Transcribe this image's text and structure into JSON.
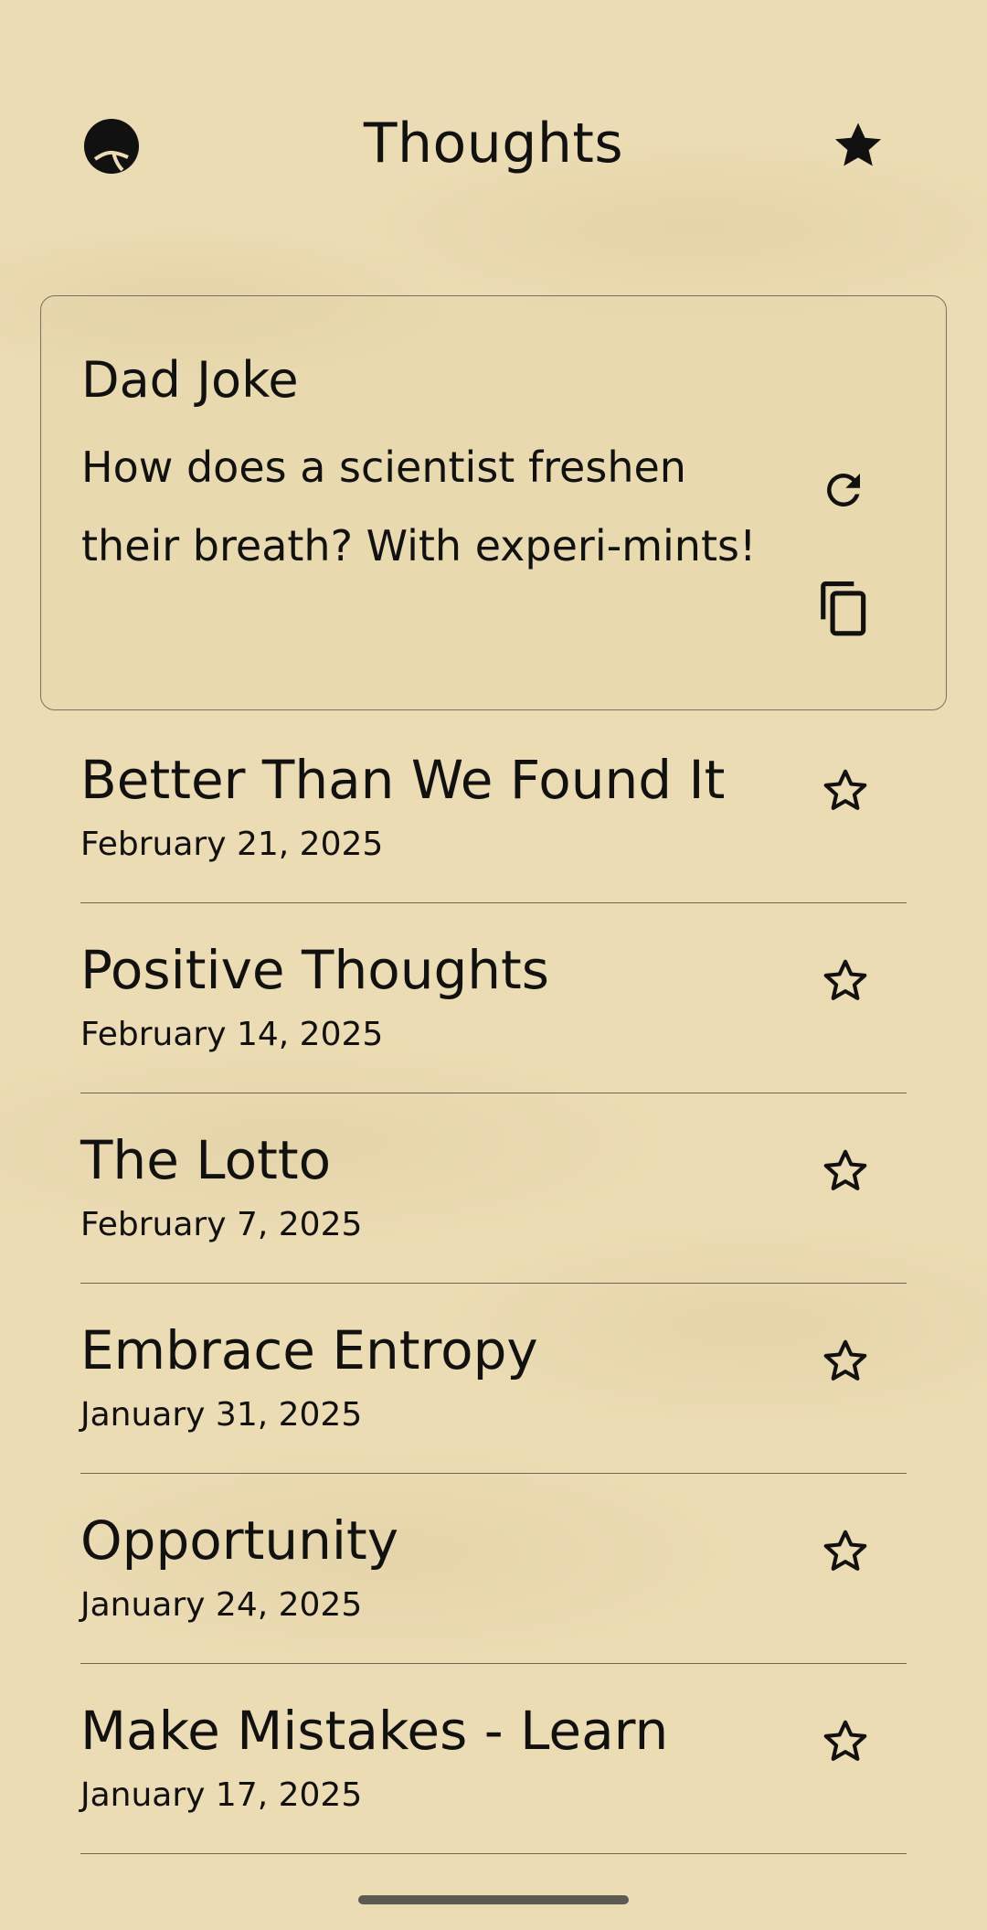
{
  "header": {
    "title": "Thoughts",
    "left_icon": "globe-icon",
    "right_icon": "star-filled-icon"
  },
  "joke": {
    "title": "Dad Joke",
    "text": "How does a scientist freshen their breath? With experi-mints!",
    "refresh_icon": "refresh-icon",
    "copy_icon": "copy-icon"
  },
  "entries": [
    {
      "title": "Better Than We Found It",
      "date": "February 21, 2025",
      "favorite": false
    },
    {
      "title": "Positive Thoughts",
      "date": "February 14, 2025",
      "favorite": false
    },
    {
      "title": "The Lotto",
      "date": "February 7, 2025",
      "favorite": false
    },
    {
      "title": "Embrace Entropy",
      "date": "January 31, 2025",
      "favorite": false
    },
    {
      "title": "Opportunity",
      "date": "January 24, 2025",
      "favorite": false
    },
    {
      "title": "Make Mistakes - Learn",
      "date": "January 17, 2025",
      "favorite": false
    }
  ],
  "colors": {
    "background": "#ecdcb3",
    "text": "#111111",
    "divider": "#6f6657"
  }
}
